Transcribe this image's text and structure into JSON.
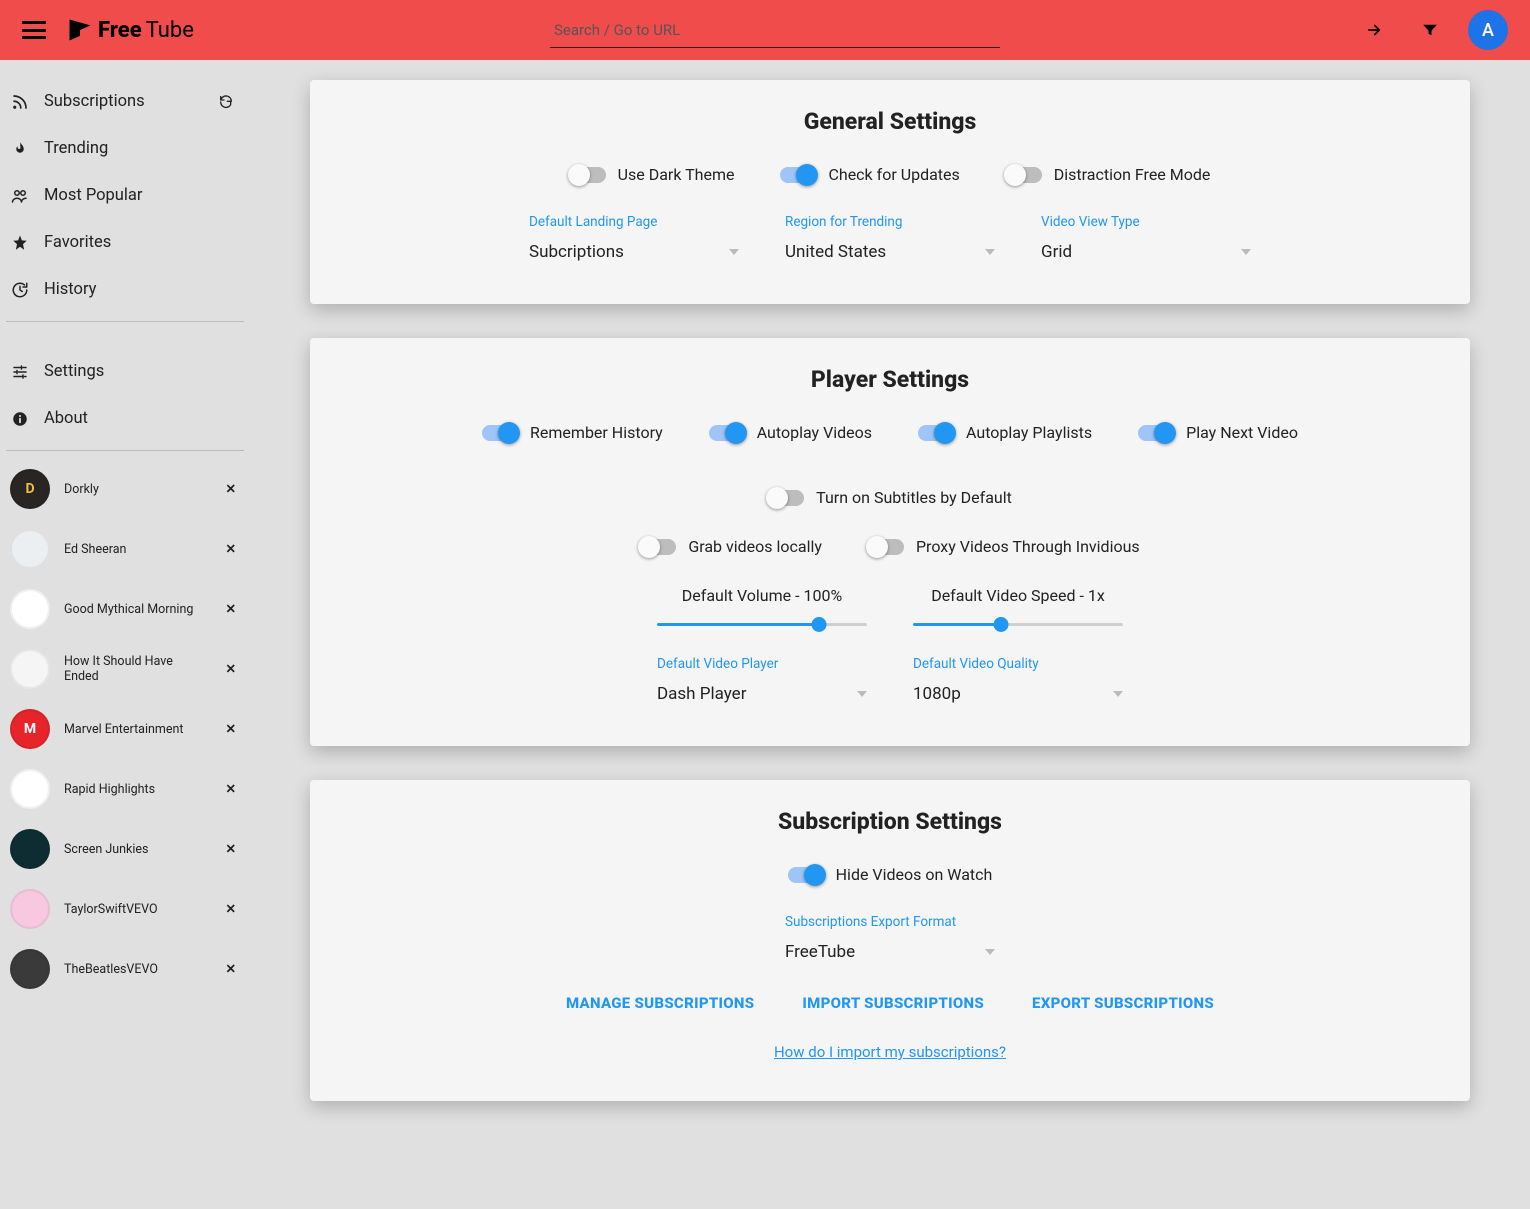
{
  "app_name_1": "Free",
  "app_name_2": "Tube",
  "header": {
    "search_placeholder": "Search / Go to URL",
    "avatar_initial": "A"
  },
  "sidebar": {
    "nav": [
      {
        "id": "subscriptions",
        "label": "Subscriptions",
        "icon": "rss",
        "refresh": true
      },
      {
        "id": "trending",
        "label": "Trending",
        "icon": "flame",
        "refresh": false
      },
      {
        "id": "popular",
        "label": "Most Popular",
        "icon": "users",
        "refresh": false
      },
      {
        "id": "favorites",
        "label": "Favorites",
        "icon": "star",
        "refresh": false
      },
      {
        "id": "history",
        "label": "History",
        "icon": "history",
        "refresh": false
      }
    ],
    "nav2": [
      {
        "id": "settings",
        "label": "Settings",
        "icon": "sliders"
      },
      {
        "id": "about",
        "label": "About",
        "icon": "info"
      }
    ],
    "channels": [
      {
        "label": "Dorkly",
        "bg": "#292522",
        "fg": "#f0c040",
        "initial": "D"
      },
      {
        "label": "Ed Sheeran",
        "bg": "#eceff1",
        "fg": "#333",
        "initial": ""
      },
      {
        "label": "Good Mythical Morning",
        "bg": "#fff",
        "fg": "#1fa9a0",
        "initial": ""
      },
      {
        "label": "How It Should Have Ended",
        "bg": "#f5f5f5",
        "fg": "#7a1f1f",
        "initial": ""
      },
      {
        "label": "Marvel Entertainment",
        "bg": "#e62429",
        "fg": "#fff",
        "initial": "M"
      },
      {
        "label": "Rapid Highlights",
        "bg": "#fff",
        "fg": "#9a2720",
        "initial": ""
      },
      {
        "label": "Screen Junkies",
        "bg": "#0e2d33",
        "fg": "#e96b63",
        "initial": ""
      },
      {
        "label": "TaylorSwiftVEVO",
        "bg": "#f7c8e0",
        "fg": "#333",
        "initial": ""
      },
      {
        "label": "TheBeatlesVEVO",
        "bg": "#3a3a3a",
        "fg": "#fff",
        "initial": ""
      }
    ]
  },
  "sections": {
    "general": {
      "title": "General Settings",
      "toggles": [
        {
          "id": "dark",
          "label": "Use Dark Theme",
          "on": false
        },
        {
          "id": "updates",
          "label": "Check for Updates",
          "on": true
        },
        {
          "id": "distract",
          "label": "Distraction Free Mode",
          "on": false
        }
      ],
      "selects": [
        {
          "id": "landing",
          "label": "Default Landing Page",
          "value": "Subcriptions"
        },
        {
          "id": "region",
          "label": "Region for Trending",
          "value": "United States"
        },
        {
          "id": "view",
          "label": "Video View Type",
          "value": "Grid"
        }
      ]
    },
    "player": {
      "title": "Player Settings",
      "toggles_row1": [
        {
          "id": "rememberhist",
          "label": "Remember History",
          "on": true
        },
        {
          "id": "autovid",
          "label": "Autoplay Videos",
          "on": true
        },
        {
          "id": "autopl",
          "label": "Autoplay Playlists",
          "on": true
        },
        {
          "id": "playnext",
          "label": "Play Next Video",
          "on": true
        },
        {
          "id": "subsdef",
          "label": "Turn on Subtitles by Default",
          "on": false
        }
      ],
      "toggles_row2": [
        {
          "id": "grablocal",
          "label": "Grab videos locally",
          "on": false
        },
        {
          "id": "proxy",
          "label": "Proxy Videos Through Invidious",
          "on": false
        }
      ],
      "sliders": [
        {
          "id": "volume",
          "label": "Default Volume - 100%",
          "pct": 77
        },
        {
          "id": "speed",
          "label": "Default Video Speed - 1x",
          "pct": 42
        }
      ],
      "selects": [
        {
          "id": "player",
          "label": "Default Video Player",
          "value": "Dash Player"
        },
        {
          "id": "quality",
          "label": "Default Video Quality",
          "value": "1080p"
        }
      ]
    },
    "subscription": {
      "title": "Subscription Settings",
      "toggle": {
        "id": "hidewatch",
        "label": "Hide Videos on Watch",
        "on": true
      },
      "select": {
        "id": "exportfmt",
        "label": "Subscriptions Export Format",
        "value": "FreeTube"
      },
      "actions": [
        {
          "id": "manage",
          "label": "MANAGE SUBSCRIPTIONS"
        },
        {
          "id": "import",
          "label": "IMPORT SUBSCRIPTIONS"
        },
        {
          "id": "export",
          "label": "EXPORT SUBSCRIPTIONS"
        }
      ],
      "help_link": "How do I import my subscriptions?"
    }
  }
}
